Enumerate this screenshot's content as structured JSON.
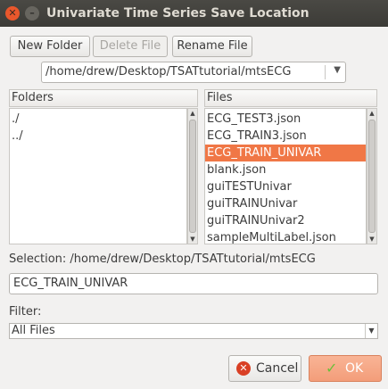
{
  "window": {
    "title": "Univariate Time Series Save Location",
    "close_glyph": "✕",
    "minimize_glyph": "–"
  },
  "toolbar": {
    "new_folder": "New Folder",
    "delete_file": "Delete File",
    "rename_file": "Rename File"
  },
  "path_combo": {
    "value": "/home/drew/Desktop/TSATtutorial/mtsECG",
    "arrow": "▼"
  },
  "folders": {
    "header": "Folders",
    "items": [
      "./",
      "../"
    ]
  },
  "files": {
    "header": "Files",
    "items": [
      "ECG_TEST3.json",
      "ECG_TRAIN3.json",
      "ECG_TRAIN_UNIVAR",
      "blank.json",
      "guiTESTUnivar",
      "guiTRAINUnivar",
      "guiTRAINUnivar2",
      "sampleMultiLabel.json"
    ],
    "selected_index": 2
  },
  "scroll_arrows": {
    "up": "▲",
    "down": "▼"
  },
  "selection": {
    "label": "Selection: /home/drew/Desktop/TSATtutorial/mtsECG",
    "value": "ECG_TRAIN_UNIVAR"
  },
  "filter": {
    "label": "Filter:",
    "value": "All Files",
    "arrow": "▼"
  },
  "buttons": {
    "cancel": "Cancel",
    "cancel_icon_glyph": "✕",
    "ok": "OK",
    "ok_icon_glyph": "✓"
  },
  "colors": {
    "selection_bg": "#f07746",
    "titlebar_bg": "#3c3b37",
    "close_button": "#e9572c",
    "ok_button": "#f39d7a"
  }
}
